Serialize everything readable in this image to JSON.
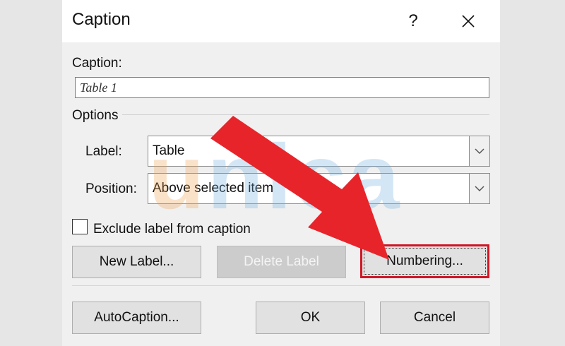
{
  "dialog": {
    "title": "Caption",
    "help_label": "?",
    "close_label": "✕"
  },
  "caption_field": {
    "label": "Caption:",
    "value": "Table 1"
  },
  "options": {
    "heading": "Options",
    "label_label": "Label:",
    "label_value": "Table",
    "position_label": "Position:",
    "position_value": "Above selected item"
  },
  "exclude_checkbox": {
    "label": "Exclude label from caption",
    "checked": false
  },
  "buttons": {
    "new_label": "New Label...",
    "delete_label": "Delete Label",
    "numbering": "Numbering...",
    "autocaption": "AutoCaption...",
    "ok": "OK",
    "cancel": "Cancel"
  },
  "watermark": {
    "first": "u",
    "rest": "nica"
  },
  "colors": {
    "arrow": "#e8242b",
    "highlight_border": "#d01625",
    "watermark_orange": "#f0a050",
    "watermark_blue": "#6fb0e0"
  },
  "icons": {
    "help": "question-mark-icon",
    "close": "close-x-icon",
    "dropdown": "chevron-down-icon",
    "annotation": "red-arrow-icon"
  }
}
